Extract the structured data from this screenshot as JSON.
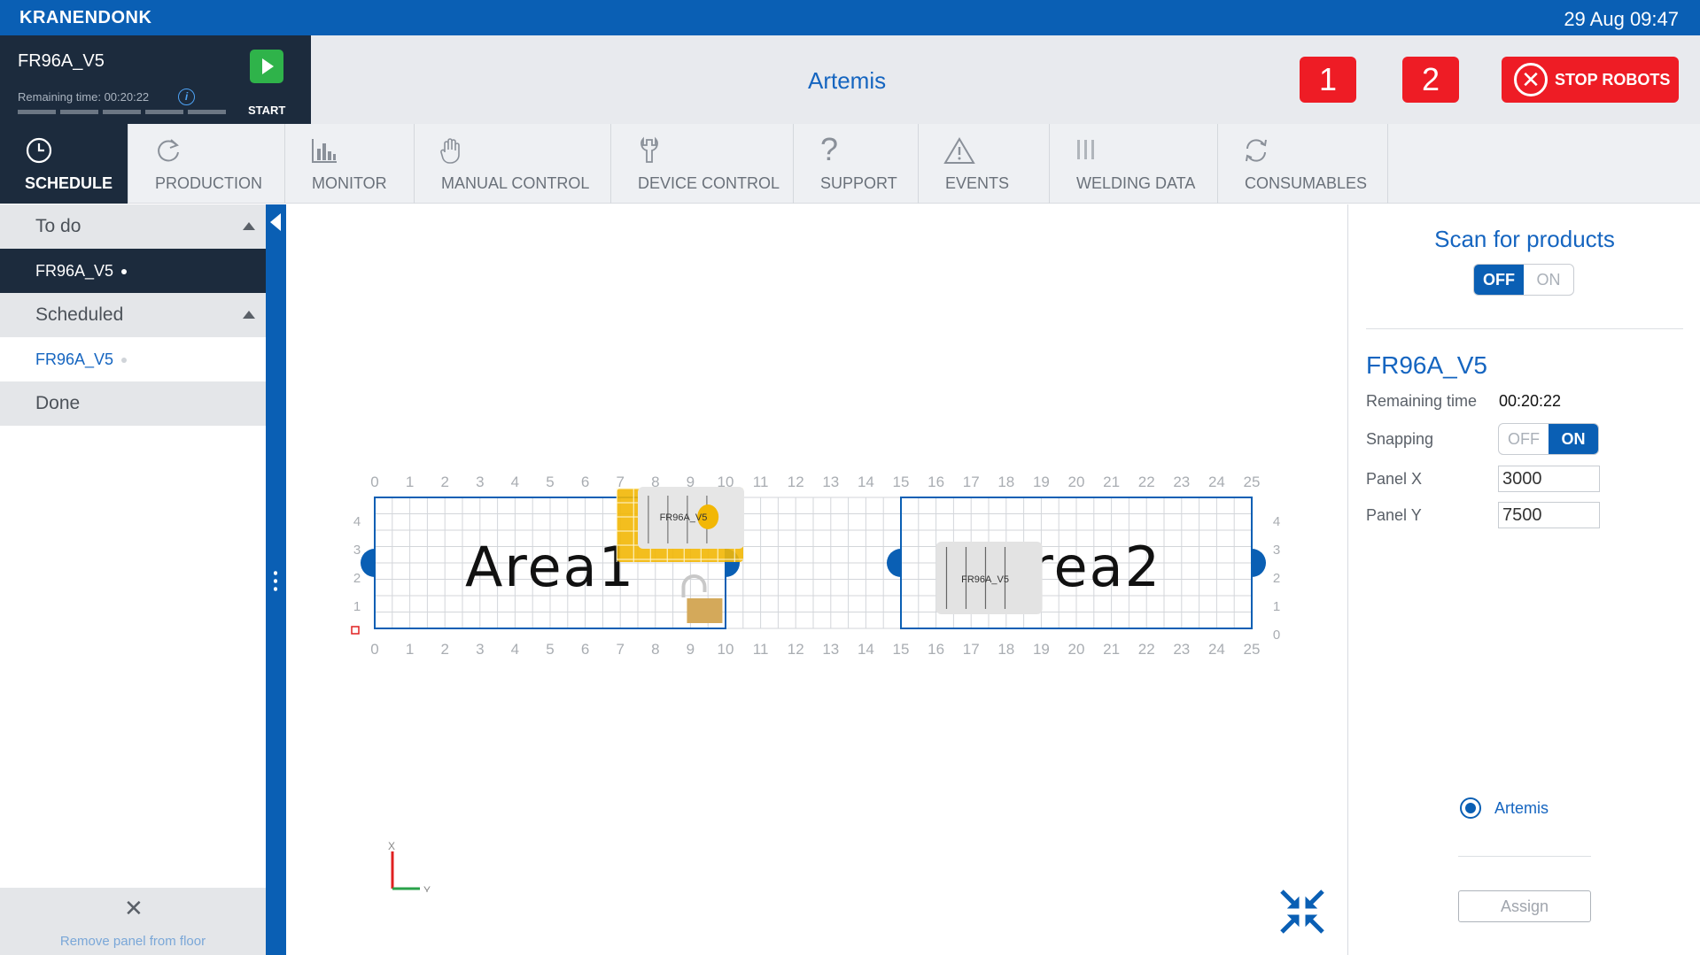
{
  "app": {
    "brand": "KRANENDONK",
    "datetime": "29 Aug 09:47"
  },
  "job": {
    "name": "FR96A_V5",
    "remaining_label": "Remaining time:",
    "remaining_time": "00:20:22",
    "start_label": "START",
    "progress_segments": 5
  },
  "header": {
    "station": "Artemis",
    "robot_buttons": [
      "1",
      "2"
    ],
    "stop_label": "STOP ROBOTS"
  },
  "nav": {
    "tabs": [
      {
        "label": "SCHEDULE",
        "icon": "clock-icon",
        "active": true
      },
      {
        "label": "PRODUCTION",
        "icon": "refresh-icon",
        "active": false
      },
      {
        "label": "MONITOR",
        "icon": "bar-chart-icon",
        "active": false
      },
      {
        "label": "MANUAL CONTROL",
        "icon": "hand-icon",
        "active": false
      },
      {
        "label": "DEVICE CONTROL",
        "icon": "wrench-icon",
        "active": false
      },
      {
        "label": "SUPPORT",
        "icon": "question-icon",
        "active": false
      },
      {
        "label": "EVENTS",
        "icon": "warning-icon",
        "active": false
      },
      {
        "label": "WELDING DATA",
        "icon": "welding-icon",
        "active": false
      },
      {
        "label": "CONSUMABLES",
        "icon": "cycle-icon",
        "active": false
      }
    ]
  },
  "sidebar": {
    "todo_header": "To do",
    "todo_items": [
      {
        "label": "FR96A_V5"
      }
    ],
    "scheduled_header": "Scheduled",
    "scheduled_items": [
      {
        "label": "FR96A_V5"
      }
    ],
    "done_header": "Done",
    "remove_label": "Remove panel from floor"
  },
  "floor": {
    "x_ticks": [
      "0",
      "1",
      "2",
      "3",
      "4",
      "5",
      "6",
      "7",
      "8",
      "9",
      "10",
      "11",
      "12",
      "13",
      "14",
      "15",
      "16",
      "17",
      "18",
      "19",
      "20",
      "21",
      "22",
      "23",
      "24",
      "25"
    ],
    "left_y_ticks": [
      "4",
      "3",
      "2",
      "1"
    ],
    "right_y_ticks": [
      "4",
      "3",
      "2",
      "1",
      "0"
    ],
    "areas": [
      {
        "label": "Area1",
        "x_start": 0,
        "x_end": 10
      },
      {
        "label": "Area2",
        "x_start": 15,
        "x_end": 25
      }
    ],
    "panel_label": "FR96A_V5",
    "axis_x_label": "X",
    "axis_y_label": "Y",
    "colors": {
      "area_border": "#0a5fb4",
      "grid": "#d3d6da",
      "tick": "#a9adb2",
      "panel_yellow": "#f2b705",
      "lock": "#d4a95a"
    }
  },
  "right_panel": {
    "scan_title": "Scan for products",
    "scan_toggle": {
      "off": "OFF",
      "on": "ON",
      "state": "OFF"
    },
    "product_name": "FR96A_V5",
    "remaining_label": "Remaining time",
    "remaining_value": "00:20:22",
    "snapping_label": "Snapping",
    "snapping_toggle": {
      "off": "OFF",
      "on": "ON",
      "state": "ON"
    },
    "panel_x_label": "Panel X",
    "panel_x_value": "3000",
    "panel_y_label": "Panel Y",
    "panel_y_value": "7500",
    "station_option": "Artemis",
    "assign_label": "Assign"
  }
}
